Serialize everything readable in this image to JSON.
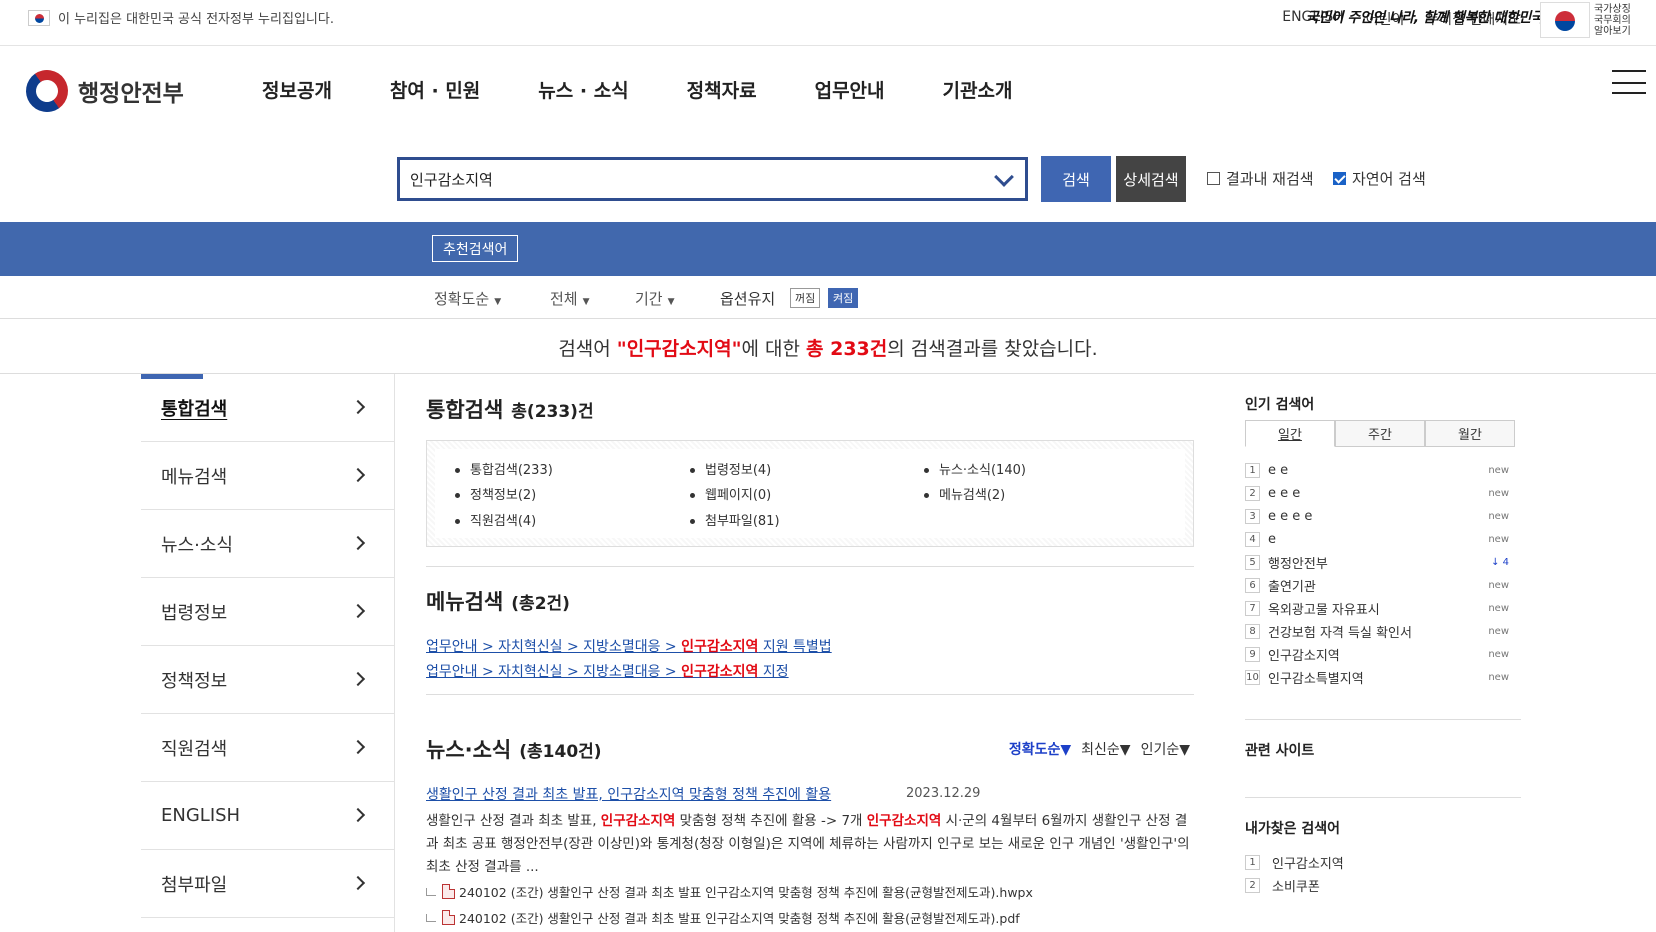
{
  "topbar": {
    "gov_notice": "이 누리집은 대한민국 공식 전자정부 누리집입니다.",
    "links": [
      "ENGLISH",
      "어린이",
      "누리집 안내지도"
    ],
    "slogan": "국민이 주인인 나라, 함께 행복한 대한민국",
    "emblem_text": "국가상징 국무회의 알아보기"
  },
  "gnb": {
    "logo": "행정안전부",
    "menu": [
      "정보공개",
      "참여 · 민원",
      "뉴스 · 소식",
      "정책자료",
      "업무안내",
      "기관소개"
    ]
  },
  "search": {
    "query": "인구감소지역",
    "search_button": "검색",
    "advanced_button": "상세검색",
    "checkbox_within": "결과내 재검색",
    "checkbox_natural": "자연어 검색",
    "within_checked": false,
    "natural_checked": true
  },
  "bluebar": {
    "recommend": "추천검색어"
  },
  "options": {
    "sort": "정확도순",
    "scope": "전체",
    "period": "기간",
    "keep_label": "옵션유지",
    "off": "꺼짐",
    "on": "켜짐"
  },
  "summary": {
    "pre": "검색어 ",
    "query": "\"인구감소지역\"",
    "mid": "에 대한 ",
    "total": "총 233건",
    "post": "의 검색결과를 찾았습니다."
  },
  "leftnav": [
    "통합검색",
    "메뉴검색",
    "뉴스·소식",
    "법령정보",
    "정책정보",
    "직원검색",
    "ENGLISH",
    "첨부파일"
  ],
  "integrated": {
    "title": "통합검색",
    "count": "총(233)건",
    "items": [
      "통합검색(233)",
      "법령정보(4)",
      "뉴스·소식(140)",
      "정책정보(2)",
      "웹페이지(0)",
      "메뉴검색(2)",
      "직원검색(4)",
      "첨부파일(81)"
    ]
  },
  "menusearch": {
    "title": "메뉴검색",
    "count": "(총2건)",
    "links": [
      {
        "path": "업무안내 > 자치혁신실 > 지방소멸대응 > ",
        "hit": "인구감소지역",
        "rest": " 지원 특별법"
      },
      {
        "path": "업무안내 > 자치혁신실 > 지방소멸대응 > ",
        "hit": "인구감소지역",
        "rest": " 지정"
      }
    ]
  },
  "news": {
    "title": "뉴스·소식",
    "count": "(총140건)",
    "sort": [
      "정확도순▼",
      "최신순▼",
      "인기순▼"
    ],
    "item_title": "생활인구 산정 결과 최초 발표, 인구감소지역 맞춤형 정책 추진에 활용",
    "item_date": "2023.12.29",
    "body_1": "생활인구 산정 결과 최초 발표, ",
    "hit_1": "인구감소지역",
    "body_2": " 맞춤형 정책 추진에 활용 -> 7개 ",
    "hit_2": "인구감소지역",
    "body_3": " 시·군의 4월부터 6월까지 생활인구 산정 결과 최초 공표 행정안전부(장관 이상민)와 통계청(청장 이형일)은 지역에 체류하는 사람까지 인구로 보는 새로운 인구 개념인 '생활인구'의 최초 산정 결과를 ...",
    "attachments": [
      "240102 (조간) 생활인구 산정 결과 최초 발표 인구감소지역 맞춤형 정책 추진에 활용(균형발전제도과).hwpx",
      "240102 (조간) 생활인구 산정 결과 최초 발표 인구감소지역 맞춤형 정책 추진에 활용(균형발전제도과).pdf"
    ]
  },
  "right": {
    "popular_title": "인기 검색어",
    "tabs": [
      "일간",
      "주간",
      "월간"
    ],
    "popular": [
      {
        "n": "1",
        "t": "e e",
        "s": "new"
      },
      {
        "n": "2",
        "t": "e e e",
        "s": "new"
      },
      {
        "n": "3",
        "t": "e e e e",
        "s": "new"
      },
      {
        "n": "4",
        "t": "e",
        "s": "new"
      },
      {
        "n": "5",
        "t": "행정안전부",
        "s": "↓   4"
      },
      {
        "n": "6",
        "t": "출연기관",
        "s": "new"
      },
      {
        "n": "7",
        "t": "옥외광고물 자유표시",
        "s": "new"
      },
      {
        "n": "8",
        "t": "건강보험 자격 득실 확인서",
        "s": "new"
      },
      {
        "n": "9",
        "t": "인구감소지역",
        "s": "new"
      },
      {
        "n": "10",
        "t": "인구감소특별지역",
        "s": "new"
      }
    ],
    "related_title": "관련 사이트",
    "mine_title": "내가찾은 검색어",
    "mine": [
      {
        "n": "1",
        "t": "인구감소지역"
      },
      {
        "n": "2",
        "t": "소비쿠폰"
      }
    ]
  }
}
